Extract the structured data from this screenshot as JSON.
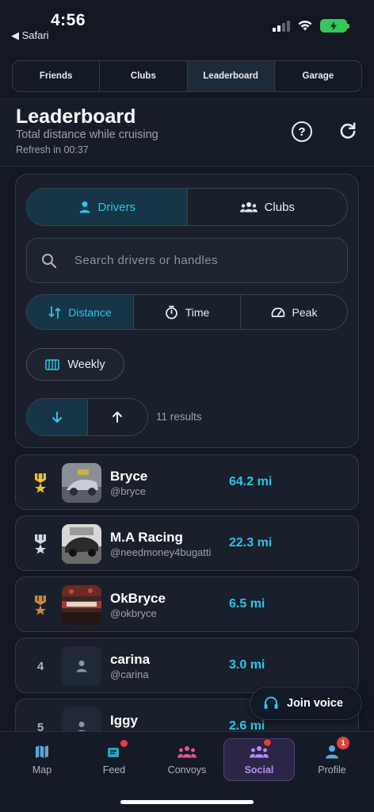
{
  "status_bar": {
    "time": "4:56",
    "back_app": "◀ Safari"
  },
  "top_tabs": [
    {
      "label": "Friends",
      "active": false
    },
    {
      "label": "Clubs",
      "active": false
    },
    {
      "label": "Leaderboard",
      "active": true
    },
    {
      "label": "Garage",
      "active": false
    }
  ],
  "header": {
    "title": "Leaderboard",
    "subtitle": "Total distance while cruising",
    "refresh_text": "Refresh in 00:37",
    "help_icon": "question-circle-icon",
    "refresh_icon": "refresh-icon"
  },
  "filters": {
    "scope": {
      "drivers_label": "Drivers",
      "clubs_label": "Clubs",
      "active": "drivers"
    },
    "search": {
      "placeholder": "Search drivers or handles",
      "value": ""
    },
    "metric": {
      "distance_label": "Distance",
      "time_label": "Time",
      "peak_label": "Peak",
      "active": "distance"
    },
    "period": {
      "label": "Weekly"
    },
    "sort": {
      "active": "descending"
    },
    "results_text": "11 results"
  },
  "leaderboard": [
    {
      "rank": "1",
      "medal": "gold",
      "name": "Bryce",
      "handle": "@bryce",
      "distance": "64.2 mi"
    },
    {
      "rank": "2",
      "medal": "silver",
      "name": "M.A Racing",
      "handle": "@needmoney4bugatti",
      "distance": "22.3 mi"
    },
    {
      "rank": "3",
      "medal": "bronze",
      "name": "OkBryce",
      "handle": "@okbryce",
      "distance": "6.5 mi"
    },
    {
      "rank": "4",
      "medal": "",
      "name": "carina",
      "handle": "@carina",
      "distance": "3.0 mi"
    },
    {
      "rank": "5",
      "medal": "",
      "name": "Iggy",
      "handle": "",
      "distance": "2.6 mi"
    }
  ],
  "join_voice": {
    "label": "Join voice"
  },
  "bottom_nav": [
    {
      "label": "Map",
      "icon": "map-icon",
      "active": false
    },
    {
      "label": "Feed",
      "icon": "feed-icon",
      "active": false
    },
    {
      "label": "Convoys",
      "icon": "convoys-icon",
      "active": false
    },
    {
      "label": "Social",
      "icon": "social-icon",
      "active": true
    },
    {
      "label": "Profile",
      "icon": "profile-icon",
      "active": false,
      "badge": "1"
    }
  ],
  "colors": {
    "background": "#121722",
    "accent_cyan": "#2cc3ea",
    "accent_purple": "#b68cf6",
    "gold": "#e8c232",
    "silver": "#d6d9de",
    "bronze": "#c98a3c",
    "badge_red": "#e53e3e"
  }
}
